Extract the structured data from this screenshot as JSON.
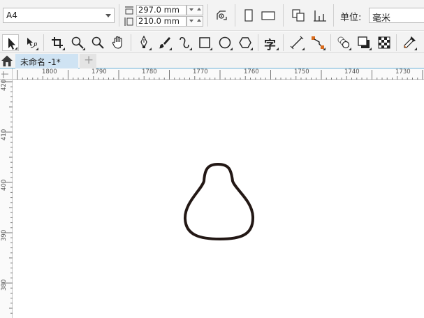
{
  "property_bar": {
    "page_size": "A4",
    "page_height": "297.0 mm",
    "page_width": "210.0 mm",
    "units_label": "单位:",
    "units_value": "毫米"
  },
  "tools": [
    {
      "name": "pick-tool",
      "icon": "arrow-pointer-icon",
      "active": true
    },
    {
      "name": "shape-tool",
      "icon": "node-shape-icon"
    },
    {
      "name": "crop-tool",
      "icon": "crop-icon"
    },
    {
      "name": "zoom-tool",
      "icon": "zoom-icon"
    },
    {
      "name": "pan-tool",
      "icon": "hand-icon"
    },
    {
      "name": "freehand-tool",
      "icon": "pen-nib-icon"
    },
    {
      "name": "artistic-media-tool",
      "icon": "brush-icon"
    },
    {
      "name": "bspline-tool",
      "icon": "curve-icon"
    },
    {
      "name": "rectangle-tool",
      "icon": "rectangle-icon"
    },
    {
      "name": "ellipse-tool",
      "icon": "ellipse-icon"
    },
    {
      "name": "polygon-tool",
      "icon": "polygon-icon"
    },
    {
      "name": "text-tool",
      "icon": "text-icon",
      "glyph": "字"
    },
    {
      "name": "parallel-dimension-tool",
      "icon": "dimension-line-icon"
    },
    {
      "name": "connector-tool",
      "icon": "connector-icon"
    },
    {
      "name": "blend-tool",
      "icon": "blend-icon"
    },
    {
      "name": "drop-shadow-tool",
      "icon": "drop-shadow-icon"
    },
    {
      "name": "transparency-tool",
      "icon": "checkerboard-icon"
    },
    {
      "name": "eyedropper-tool",
      "icon": "eyedropper-icon"
    }
  ],
  "tabs": {
    "document_name": "未命名 -1*",
    "add_symbol": "+"
  },
  "rulers": {
    "horizontal_labels": [
      "1800",
      "1790",
      "1780",
      "1770",
      "1760",
      "1750",
      "1740",
      "1730"
    ],
    "vertical_labels": [
      "420",
      "410",
      "400",
      "390",
      "380"
    ]
  },
  "colors": {
    "accent": "#6ab0d8",
    "active_tab": "#cfe3f3",
    "shape_stroke": "#231815"
  },
  "canvas": {
    "shape": "gourd-outline"
  }
}
